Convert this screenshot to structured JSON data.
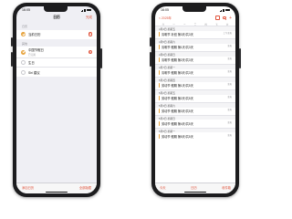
{
  "status": {
    "time_left": "16:05",
    "time_right": "16:05"
  },
  "left_screen": {
    "nav_title": "日历",
    "done": "完成",
    "sections": [
      {
        "header": "日历",
        "rows": [
          {
            "name": "当前日历",
            "sub": "",
            "checked": true
          }
        ]
      },
      {
        "header": "其他",
        "rows": [
          {
            "name": "中国节假日",
            "sub": "已订阅",
            "checked": true
          },
          {
            "name": "生日",
            "sub": "",
            "checked": false
          },
          {
            "name": "Siri 建议",
            "sub": "",
            "checked": false
          }
        ]
      }
    ],
    "bottom_left": "添加日历",
    "bottom_right": "全部隐藏"
  },
  "right_screen": {
    "back": "< 2025年",
    "weekdays": [
      "日",
      "一",
      "二",
      "三",
      "四",
      "五",
      "六"
    ],
    "days": [
      {
        "header": "4月4日 星期五",
        "events": [
          {
            "title": "清明节 补班 第3天/共3天",
            "time": "上午全天"
          }
        ]
      },
      {
        "header": "4月5日 星期六",
        "events": [
          {
            "title": "清明节 假期 第1天/共3天",
            "time": "全天"
          }
        ]
      },
      {
        "header": "4月6日 星期日",
        "events": [
          {
            "title": "清明节 假期 第2天/共3天",
            "time": "全天"
          }
        ]
      },
      {
        "header": "4月7日 星期一",
        "events": [
          {
            "title": "清明节 假期 第3天/共3天",
            "time": "全天"
          }
        ]
      },
      {
        "header": "5月1日 星期四",
        "events": [
          {
            "title": "劳动节 假期 第1天/共5天",
            "time": "全天"
          }
        ]
      },
      {
        "header": "5月2日 星期五",
        "events": [
          {
            "title": "劳动节 假期 第2天/共5天",
            "time": "全天"
          }
        ]
      },
      {
        "header": "5月3日 星期六",
        "events": [
          {
            "title": "劳动节 假期 第3天/共5天",
            "time": "全天"
          }
        ]
      },
      {
        "header": "5月4日 星期日",
        "events": [
          {
            "title": "劳动节 假期 第4天/共5天",
            "time": "全天"
          }
        ]
      },
      {
        "header": "5月5日 星期一",
        "events": [
          {
            "title": "劳动节 假期 第5天/共5天",
            "time": "全天"
          }
        ]
      }
    ],
    "bottom_left": "今天",
    "bottom_center": "日历",
    "bottom_right": "收件箱"
  }
}
